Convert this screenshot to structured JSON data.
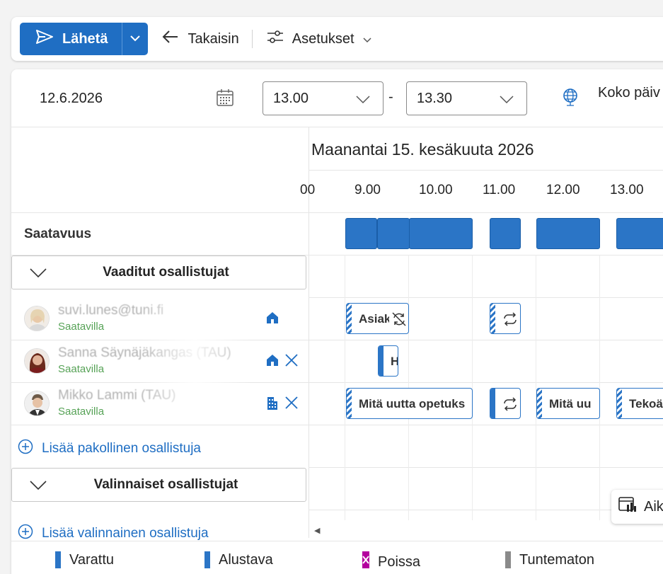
{
  "toolbar": {
    "send_label": "Lähetä",
    "back_label": "Takaisin",
    "settings_label": "Asetukset"
  },
  "datetime": {
    "date": "12.6.2026",
    "start_time": "13.00",
    "dash": "-",
    "end_time": "13.30",
    "all_day_label": "Koko päiv"
  },
  "scheduler": {
    "day_title": "Maanantai 15. kesäkuuta 2026",
    "hours": [
      "00",
      "9.00",
      "10.00",
      "11.00",
      "12.00",
      "13.00"
    ],
    "availability_label": "Saatavuus"
  },
  "required": {
    "header": "Vaaditut osallistujat",
    "add_label": "Lisää pakollinen osallistuja",
    "people": [
      {
        "name": "suvi.lunes@tuni.fi",
        "status": "Saatavilla"
      },
      {
        "name": "Sanna Säynäjäkangas (TAU)",
        "status": "Saatavilla"
      },
      {
        "name": "Mikko Lammi (TAU)",
        "status": "Saatavilla"
      }
    ]
  },
  "optional": {
    "header": "Valinnaiset osallistujat",
    "add_label": "Lisää valinnainen osallistuja"
  },
  "events": {
    "e1": "Asiak",
    "e2": "H",
    "e3": "Mitä uutta opetuks",
    "e4": "Mitä uu",
    "e5": "Tekoä"
  },
  "aika_label": "Aik",
  "legend": [
    {
      "label": "Varattu",
      "color": "#2b75c6"
    },
    {
      "label": "Alustava",
      "color": "#2b75c6"
    },
    {
      "label": "Poissa",
      "color": "#b4009e"
    },
    {
      "label": "Tuntematon",
      "color": "#8a8a8a"
    }
  ]
}
